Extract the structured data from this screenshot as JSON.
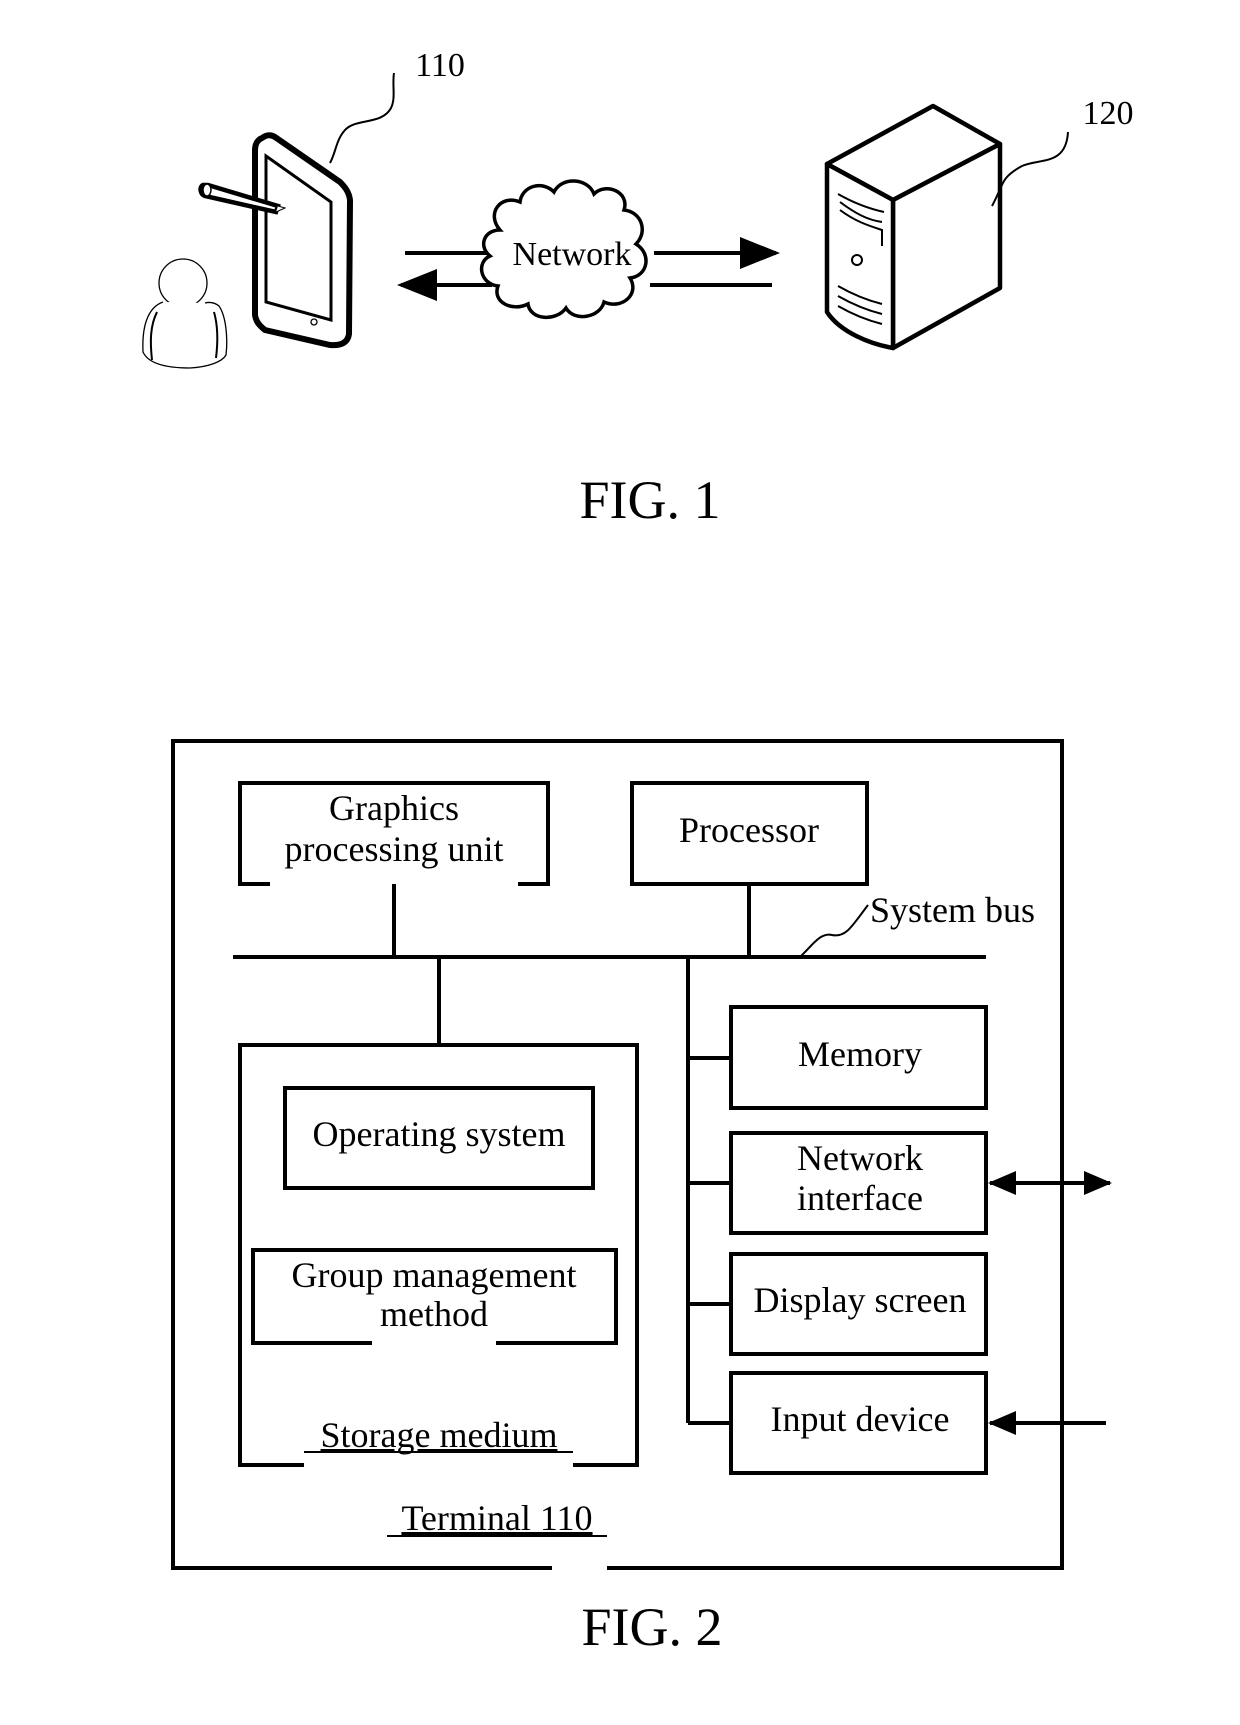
{
  "fig1": {
    "caption": "FIG. 1",
    "terminal_ref": "110",
    "server_ref": "120",
    "network_label": "Network"
  },
  "fig2": {
    "caption": "FIG. 2",
    "container_label": "Terminal 110",
    "system_bus_label": "System bus",
    "gpu": {
      "line1": "Graphics",
      "line2": "processing unit"
    },
    "processor": "Processor",
    "storage": {
      "label": "Storage medium",
      "operating_system": "Operating system",
      "group_method": {
        "line1": "Group management",
        "line2": "method"
      }
    },
    "peripherals": {
      "memory": "Memory",
      "network_interface": {
        "line1": "Network",
        "line2": "interface"
      },
      "display_screen": "Display screen",
      "input_device": "Input device"
    }
  }
}
